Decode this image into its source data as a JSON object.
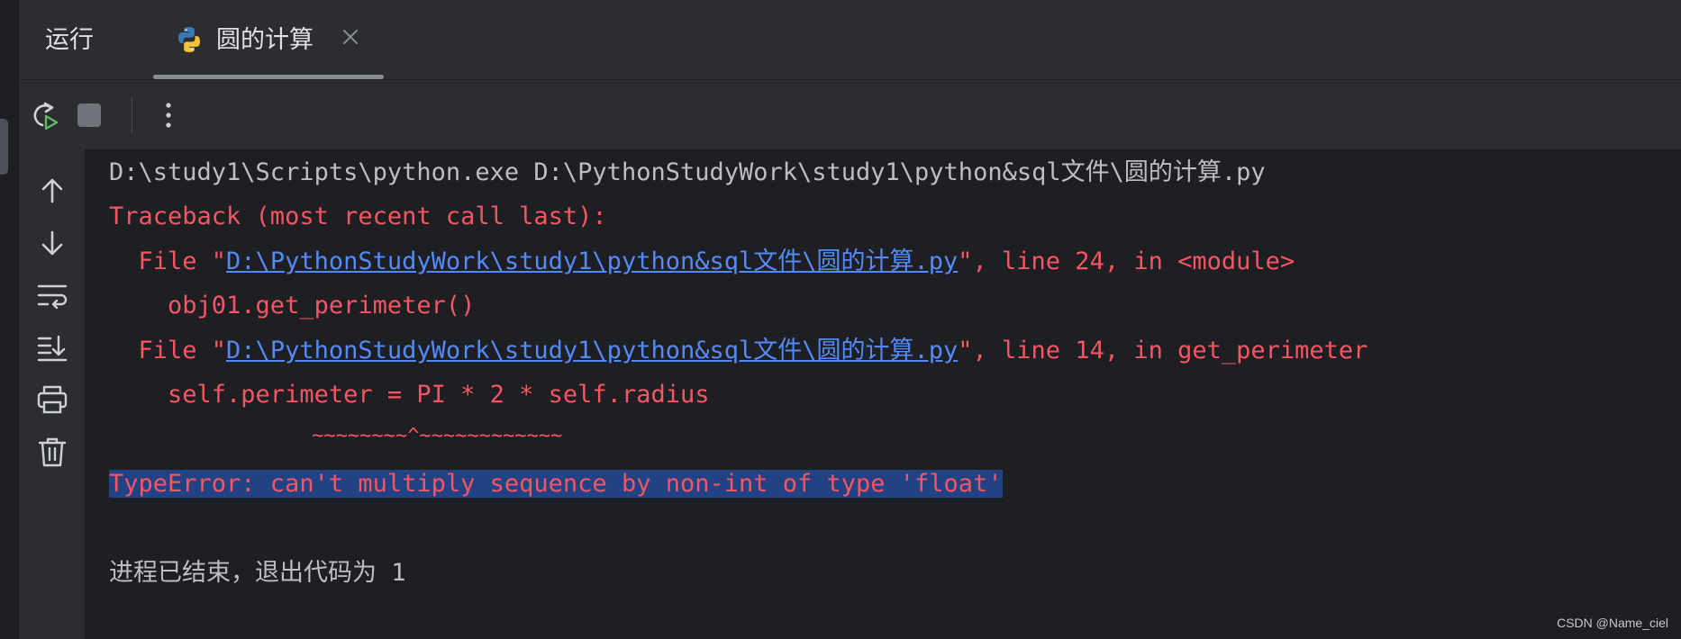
{
  "tool_window": {
    "title": "运行"
  },
  "tab": {
    "title": "圆的计算",
    "icon": "python-icon"
  },
  "toolbar": {
    "buttons": [
      "rerun-icon",
      "stop-icon",
      "more-icon"
    ]
  },
  "side_actions": [
    "arrow-up-icon",
    "arrow-down-icon",
    "soft-wrap-icon",
    "scroll-to-end-icon",
    "print-icon",
    "trash-icon"
  ],
  "console": {
    "command": "D:\\study1\\Scripts\\python.exe D:\\PythonStudyWork\\study1\\python&sql文件\\圆的计算.py",
    "traceback_header": "Traceback (most recent call last):",
    "frame1": {
      "prefix": "  File \"",
      "path": "D:\\PythonStudyWork\\study1\\python&sql文件\\圆的计算.py",
      "suffix": "\", line 24, in <module>",
      "code": "    obj01.get_perimeter()"
    },
    "frame2": {
      "prefix": "  File \"",
      "path": "D:\\PythonStudyWork\\study1\\python&sql文件\\圆的计算.py",
      "suffix": "\", line 14, in get_perimeter",
      "code": "    self.perimeter = PI * 2 * self.radius",
      "marker": "                 ~~~~~~~~^~~~~~~~~~~~~"
    },
    "error": "TypeError: can't multiply sequence by non-int of type 'float'",
    "exit_message": "进程已结束，退出代码为 1"
  },
  "watermark": "CSDN @Name_ciel",
  "colors": {
    "background": "#1e1f22",
    "panel": "#2b2d30",
    "error": "#f75464",
    "link": "#548af7",
    "selection": "#214283",
    "text": "#bcbec4"
  }
}
